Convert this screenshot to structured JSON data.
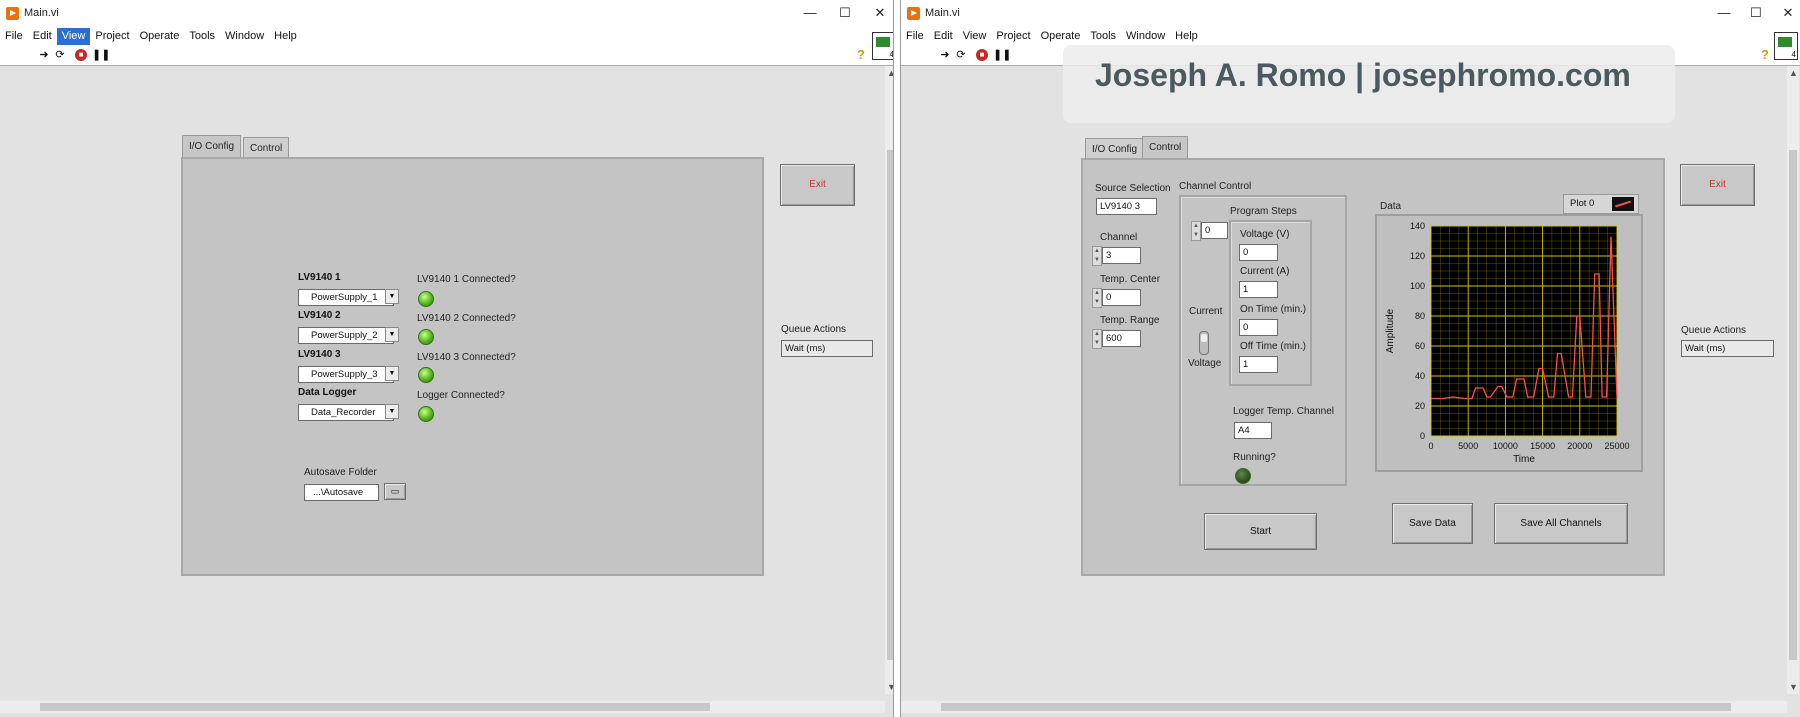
{
  "left": {
    "title": "Main.vi",
    "controls": {
      "min": "—",
      "max": "☐",
      "close": "✕"
    },
    "menu": [
      "File",
      "Edit",
      "View",
      "Project",
      "Operate",
      "Tools",
      "Window",
      "Help"
    ],
    "active_menu": "View",
    "tabs": [
      "I/O Config",
      "Control"
    ],
    "exit_label": "Exit",
    "devices": [
      {
        "name": "LV9140 1",
        "value": "PowerSupply_1",
        "status": "LV9140 1 Connected?"
      },
      {
        "name": "LV9140 2",
        "value": "PowerSupply_2",
        "status": "LV9140 2 Connected?"
      },
      {
        "name": "LV9140 3",
        "value": "PowerSupply_3",
        "status": "LV9140 3 Connected?"
      },
      {
        "name": "Data Logger",
        "value": "Data_Recorder",
        "status": "Logger Connected?"
      }
    ],
    "autosave_label": "Autosave Folder",
    "autosave_value": "...\\Autosave",
    "queue_label": "Queue Actions",
    "queue_value": "Wait (ms)"
  },
  "right": {
    "title": "Main.vi",
    "controls": {
      "min": "—",
      "max": "☐",
      "close": "✕"
    },
    "menu": [
      "File",
      "Edit",
      "View",
      "Project",
      "Operate",
      "Tools",
      "Window",
      "Help"
    ],
    "watermark": "Joseph A. Romo | josephromo.com",
    "tabs": [
      "I/O Config",
      "Control"
    ],
    "exit_label": "Exit",
    "source_selection_label": "Source Selection",
    "source_selection_value": "LV9140 3",
    "channel_label": "Channel",
    "channel_value": "3",
    "temp_center_label": "Temp. Center",
    "temp_center_value": "0",
    "temp_range_label": "Temp. Range",
    "temp_range_value": "600",
    "channel_control_label": "Channel Control",
    "step_index_value": "0",
    "program_steps_label": "Program Steps",
    "voltage_label": "Voltage (V)",
    "voltage_value": "0",
    "current_label": "Current (A)",
    "current_value": "1",
    "on_time_label": "On Time (min.)",
    "on_time_value": "0",
    "off_time_label": "Off Time (min.)",
    "off_time_value": "1",
    "mode_current_label": "Current",
    "mode_voltage_label": "Voltage",
    "logger_temp_label": "Logger Temp. Channel",
    "logger_temp_value": "A4",
    "running_label": "Running?",
    "start_label": "Start",
    "data_label": "Data",
    "plot_legend": "Plot 0",
    "save_data_label": "Save Data",
    "save_all_label": "Save All Channels",
    "queue_label": "Queue Actions",
    "queue_value": "Wait (ms)"
  },
  "chart_data": {
    "type": "line",
    "title": "",
    "xlabel": "Time",
    "ylabel": "Amplitude",
    "xlim": [
      0,
      25000
    ],
    "ylim": [
      0,
      140
    ],
    "xticks": [
      "0",
      "5000",
      "10000",
      "15000",
      "20000",
      "25000"
    ],
    "yticks": [
      "0",
      "20",
      "40",
      "60",
      "80",
      "100",
      "120",
      "140"
    ],
    "grid": true,
    "legend": "top-right",
    "colors": {
      "background": "#000000",
      "grid": "#d4c400",
      "line": "#ff4d4d"
    },
    "series": [
      {
        "name": "Plot 0",
        "x": [
          0,
          1500,
          3000,
          4500,
          5500,
          6000,
          7000,
          7500,
          8000,
          9000,
          9500,
          10200,
          11000,
          11500,
          12500,
          13000,
          13800,
          14500,
          15000,
          15800,
          16500,
          17000,
          17500,
          18500,
          19000,
          19600,
          20000,
          20800,
          21500,
          22000,
          22600,
          23000,
          23600,
          24200,
          25000
        ],
        "y": [
          25,
          25,
          26,
          25,
          25,
          32,
          32,
          26,
          26,
          33,
          33,
          26,
          26,
          38,
          38,
          26,
          26,
          45,
          45,
          26,
          26,
          55,
          55,
          26,
          26,
          80,
          80,
          26,
          26,
          108,
          108,
          26,
          26,
          133,
          25
        ]
      }
    ]
  }
}
